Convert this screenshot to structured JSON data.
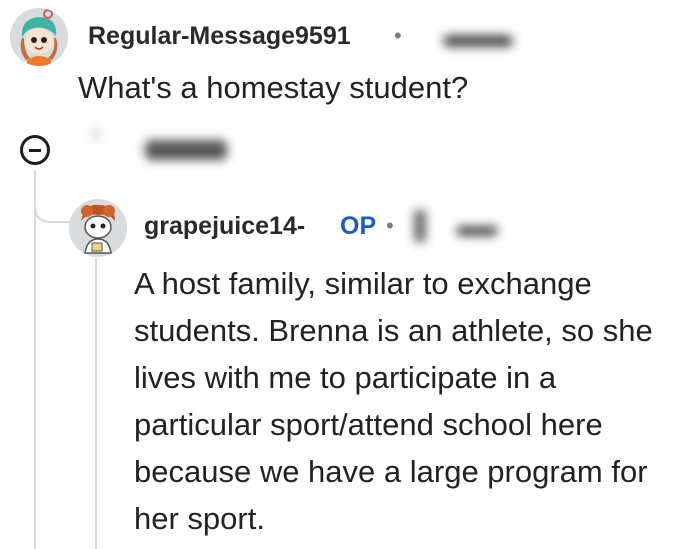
{
  "comments": [
    {
      "username": "Regular-Message9591",
      "body": "What's a homestay student?"
    },
    {
      "username": "grapejuice14-",
      "badge": "OP",
      "body_lines": [
        "A host family, similar to exchange",
        "students. Brenna is an athlete, so she",
        "lives with me to participate in a",
        "particular sport/attend school here",
        "because we have a large program for",
        "her sport."
      ]
    }
  ],
  "separator": "•",
  "icons": {
    "collapse": "minus-circle-icon",
    "avatar_1": "snoo-avatar-icon",
    "avatar_2": "snoo-avatar-icon"
  },
  "colors": {
    "op_badge": "#1b5fb8",
    "thread_line": "#d9d9d9",
    "text": "#222222"
  }
}
